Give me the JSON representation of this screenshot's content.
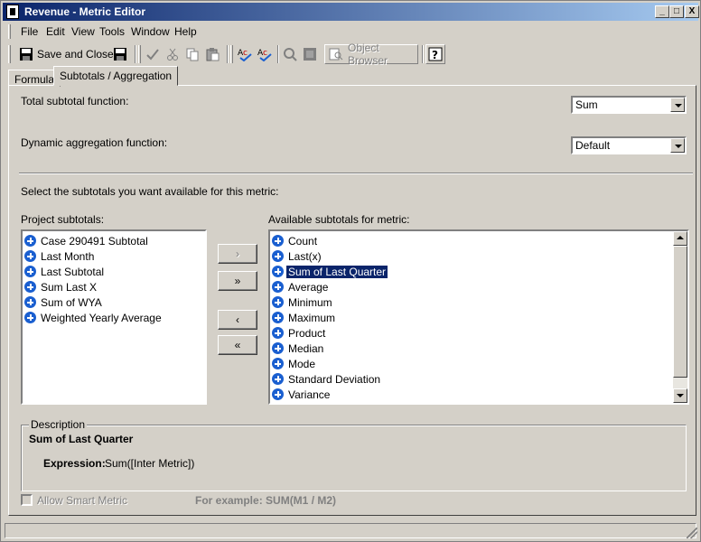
{
  "window": {
    "title": "Revenue - Metric Editor",
    "minimize_glyph": "_",
    "maximize_glyph": "□",
    "close_glyph": "X"
  },
  "menu": {
    "items": [
      "File",
      "Edit",
      "View",
      "Tools",
      "Window",
      "Help"
    ]
  },
  "toolbar": {
    "save_close_label": "Save and Close",
    "object_browser_label": "Object Browser"
  },
  "tabs": [
    {
      "label": "Formula",
      "active": false
    },
    {
      "label": "Subtotals / Aggregation",
      "active": true
    }
  ],
  "subtotals": {
    "total_subtotal_label": "Total subtotal function:",
    "total_subtotal_value": "Sum",
    "dynamic_agg_label": "Dynamic aggregation function:",
    "dynamic_agg_value": "Default",
    "instruction": "Select the subtotals you want available for this metric:",
    "project_label": "Project subtotals:",
    "project_items": [
      "Case 290491 Subtotal",
      "Last Month",
      "Last Subtotal",
      "Sum Last X",
      "Sum of WYA",
      "Weighted Yearly Average"
    ],
    "available_label": "Available subtotals for metric:",
    "available_items": [
      "Count",
      "Last(x)",
      "Sum of Last Quarter",
      "Average",
      "Minimum",
      "Maximum",
      "Product",
      "Median",
      "Mode",
      "Standard Deviation",
      "Variance"
    ],
    "selected_available": "Sum of Last Quarter",
    "buttons": {
      "add": "›",
      "add_all": "»",
      "remove": "‹",
      "remove_all": "«"
    }
  },
  "description": {
    "group_label": "Description",
    "name": "Sum of Last Quarter",
    "expression_label": "Expression:",
    "expression_value": "Sum([Inter Metric])"
  },
  "smart_metric": {
    "label": "Allow Smart Metric",
    "example": "For example: SUM(M1 / M2)"
  },
  "colors": {
    "accent": "#0a246a",
    "face": "#d4d0c8",
    "plus_icon": "#1a5fd0"
  }
}
